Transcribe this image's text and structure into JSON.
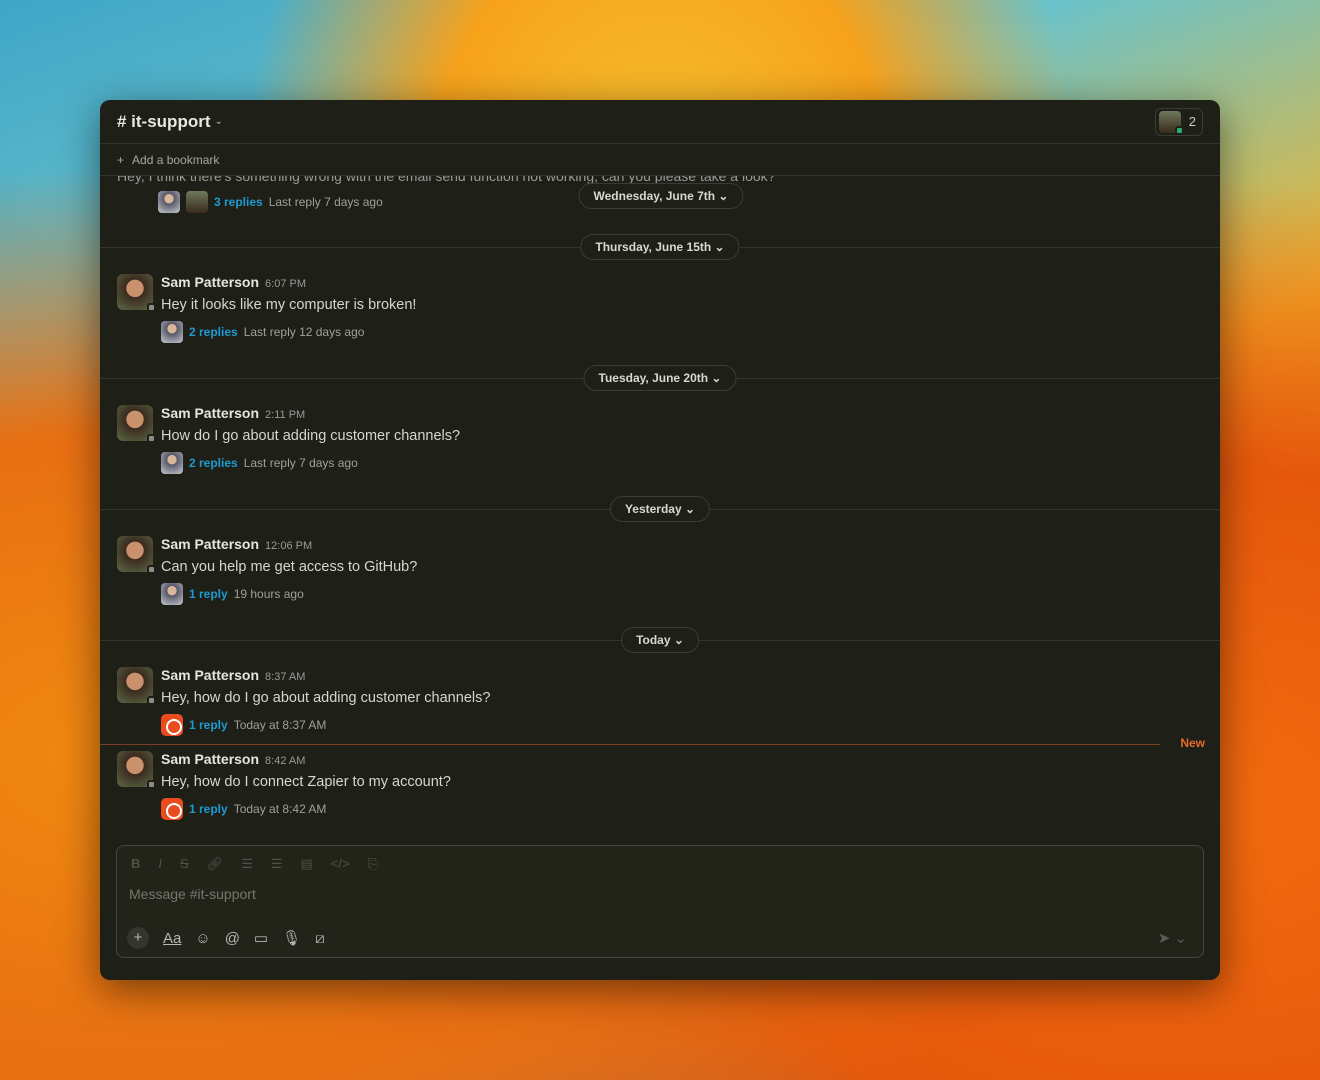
{
  "channel": {
    "name": "# it-support",
    "member_count": "2",
    "bookmark": "Add a bookmark"
  },
  "partial_message": "Hey, I think there's something wrong with the email send function not working, can you please take a look?",
  "top_thread": {
    "replies": "3 replies",
    "last": "Last reply 7 days ago"
  },
  "dates": [
    "Wednesday, June 7th",
    "Thursday, June 15th",
    "Tuesday, June 20th",
    "Yesterday",
    "Today"
  ],
  "messages": [
    {
      "name": "Sam Patterson",
      "time": "6:07 PM",
      "text": "Hey it looks like my computer is broken!",
      "replies": "2 replies",
      "last": "Last reply 12 days ago"
    },
    {
      "name": "Sam Patterson",
      "time": "2:11 PM",
      "text": "How do I go about adding customer channels?",
      "replies": "2 replies",
      "last": "Last reply 7 days ago"
    },
    {
      "name": "Sam Patterson",
      "time": "12:06 PM",
      "text": "Can you help me get access to GitHub?",
      "replies": "1 reply",
      "last": "19 hours ago"
    },
    {
      "name": "Sam Patterson",
      "time": "8:37 AM",
      "text": "Hey, how do I go about adding customer channels?",
      "replies": "1 reply",
      "last": "Today at 8:37 AM"
    },
    {
      "name": "Sam Patterson",
      "time": "8:42 AM",
      "text": "Hey, how do I connect Zapier to my account?",
      "replies": "1 reply",
      "last": "Today at 8:42 AM"
    }
  ],
  "new_label": "New",
  "composer": {
    "placeholder": "Message #it-support"
  }
}
